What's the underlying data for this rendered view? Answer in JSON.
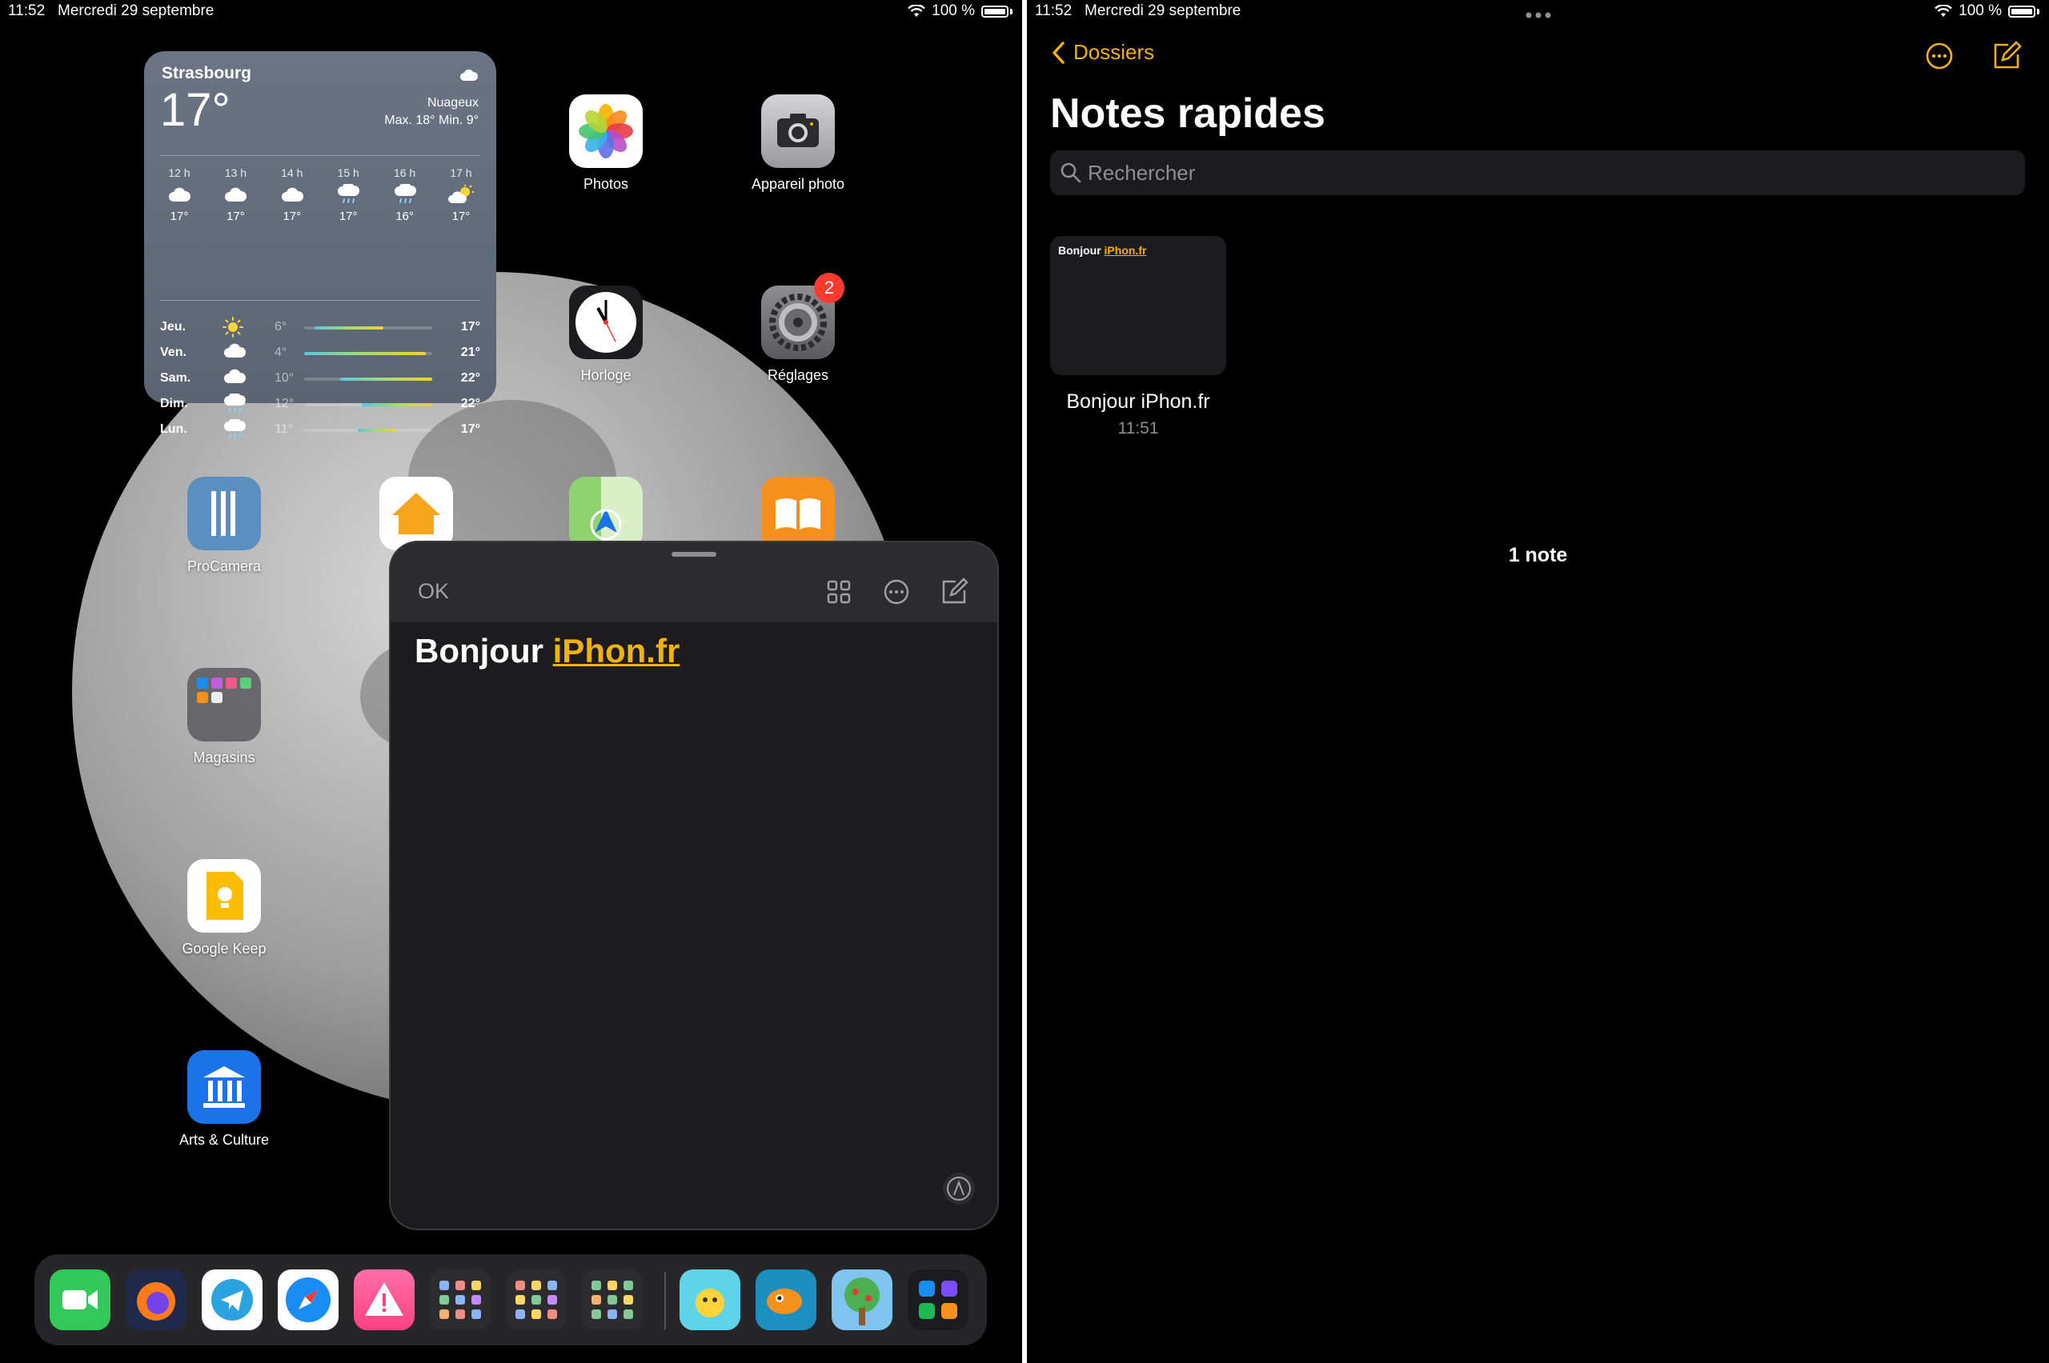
{
  "status_left": {
    "time": "11:52",
    "date": "Mercredi 29 septembre",
    "battery": "100 %"
  },
  "status_right": {
    "time": "11:52",
    "date": "Mercredi 29 septembre",
    "battery": "100 %"
  },
  "weather": {
    "city": "Strasbourg",
    "temp": "17°",
    "condition": "Nuageux",
    "range": "Max. 18° Min. 9°",
    "hourly": [
      {
        "time": "12 h",
        "icon": "cloud-icon",
        "temp": "17°"
      },
      {
        "time": "13 h",
        "icon": "cloud-icon",
        "temp": "17°"
      },
      {
        "time": "14 h",
        "icon": "cloud-icon",
        "temp": "17°"
      },
      {
        "time": "15 h",
        "icon": "cloud-rain-icon",
        "temp": "17°"
      },
      {
        "time": "16 h",
        "icon": "cloud-rain-icon",
        "temp": "16°"
      },
      {
        "time": "17 h",
        "icon": "sun-cloud-icon",
        "temp": "17°"
      }
    ],
    "daily": [
      {
        "day": "Jeu.",
        "icon": "sun-icon",
        "low": "6°",
        "high": "17°",
        "range": [
          0.08,
          0.62
        ]
      },
      {
        "day": "Ven.",
        "icon": "cloud-icon",
        "low": "4°",
        "high": "21°",
        "range": [
          0.0,
          0.95
        ]
      },
      {
        "day": "Sam.",
        "icon": "cloud-icon",
        "low": "10°",
        "high": "22°",
        "range": [
          0.28,
          1.0
        ]
      },
      {
        "day": "Dim.",
        "icon": "cloud-rain-icon",
        "low": "12°",
        "high": "22°",
        "range": [
          0.45,
          1.0
        ]
      },
      {
        "day": "Lun.",
        "icon": "cloud-rain-icon",
        "low": "11°",
        "high": "17°",
        "range": [
          0.42,
          0.72
        ]
      }
    ]
  },
  "apps": {
    "photos": "Photos",
    "camera": "Appareil photo",
    "clock": "Horloge",
    "settings": "Réglages",
    "settings_badge": "2",
    "procamera": "ProCamera",
    "magasins": "Magasins",
    "keep": "Google Keep",
    "arts": "Arts & Culture"
  },
  "quicknote": {
    "ok": "OK",
    "text_plain": "Bonjour ",
    "text_link": "iPhon.fr"
  },
  "dock": {
    "apps": [
      "FaceTime",
      "Firefox",
      "Telegram",
      "Safari",
      "Alerte",
      "Dossier 1",
      "Dossier 2",
      "Dossier 3",
      "Dessin",
      "Poisson",
      "Arbre",
      "Bibliothèque"
    ]
  },
  "notes": {
    "back_label": "Dossiers",
    "title": "Notes rapides",
    "search_placeholder": "Rechercher",
    "note": {
      "thumb_plain": "Bonjour ",
      "thumb_link": "iPhon.fr",
      "title": "Bonjour iPhon.fr",
      "time": "11:51"
    },
    "count": "1 note"
  },
  "colors": {
    "accent": "#f2b20e",
    "badge": "#ff3b30"
  }
}
